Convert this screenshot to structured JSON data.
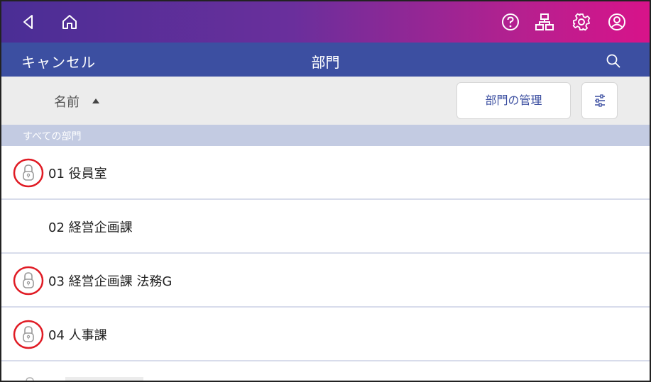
{
  "title_bar": {
    "cancel_label": "キャンセル",
    "title": "部門"
  },
  "top_bar": {
    "icons": [
      "back-icon",
      "home-icon",
      "help-icon",
      "network-icon",
      "settings-icon",
      "account-icon"
    ]
  },
  "toolbar": {
    "sort_label": "名前",
    "sort_direction": "ascending",
    "manage_button_label": "部門の管理",
    "filter_icon": "filter-icon"
  },
  "section": {
    "header": "すべての部門"
  },
  "departments": [
    {
      "label": "01 役員室",
      "locked": true
    },
    {
      "label": "02 経営企画課",
      "locked": false
    },
    {
      "label": "03 経営企画課 法務G",
      "locked": true
    },
    {
      "label": "04 人事課",
      "locked": true
    }
  ],
  "colors": {
    "gradient_start": "#4a2e95",
    "gradient_end": "#d8138a",
    "title_bar": "#3c4fa1",
    "section_header": "#c3cbe2",
    "lock_highlight": "#e01b24"
  }
}
